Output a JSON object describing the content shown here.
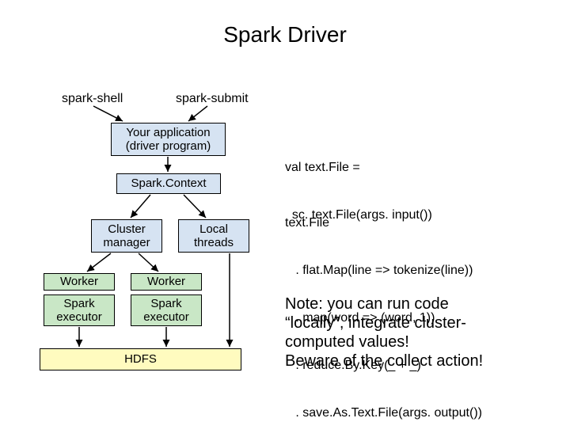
{
  "title": "Spark Driver",
  "labels": {
    "spark_shell": "spark-shell",
    "spark_submit": "spark-submit"
  },
  "boxes": {
    "your_app_l1": "Your application",
    "your_app_l2": "(driver program)",
    "spark_context": "Spark.Context",
    "cluster_mgr_l1": "Cluster",
    "cluster_mgr_l2": "manager",
    "local_threads_l1": "Local",
    "local_threads_l2": "threads",
    "worker1": "Worker",
    "worker2": "Worker",
    "spark_exec1_l1": "Spark",
    "spark_exec1_l2": "executor",
    "spark_exec2_l1": "Spark",
    "spark_exec2_l2": "executor",
    "hdfs": "HDFS"
  },
  "code1_l1": "val text.File =",
  "code1_l2": "  sc. text.File(args. input())",
  "code2_l1": "text.File",
  "code2_l2": "   . flat.Map(line => tokenize(line))",
  "code2_l3": "   . map(word => (word, 1))",
  "code2_l4": "   . reduce.By.Key(_ + _)",
  "code2_l5": "   . save.As.Text.File(args. output())",
  "note_l1": "Note: you can run code",
  "note_l2": "“locally”, integrate cluster-",
  "note_l3": "computed values!",
  "note_l4": "Beware of the collect action!"
}
